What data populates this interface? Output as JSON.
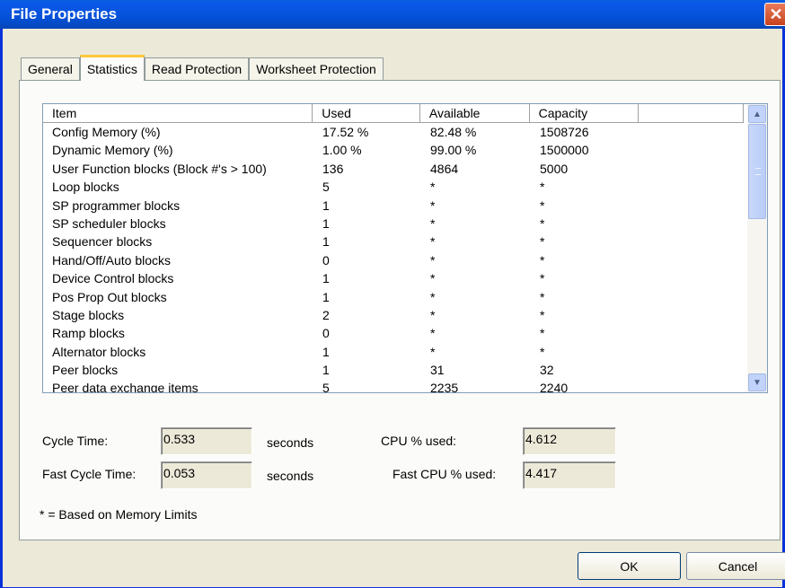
{
  "window": {
    "title": "File Properties",
    "close_glyph": "✕"
  },
  "tabs": [
    {
      "label": "General"
    },
    {
      "label": "Statistics"
    },
    {
      "label": "Read Protection"
    },
    {
      "label": "Worksheet Protection"
    }
  ],
  "table": {
    "columns": [
      "Item",
      "Used",
      "Available",
      "Capacity"
    ],
    "rows": [
      [
        "Config Memory (%)",
        "17.52 %",
        "82.48 %",
        "1508726"
      ],
      [
        "Dynamic Memory (%)",
        "1.00 %",
        "99.00 %",
        "1500000"
      ],
      [
        "User Function blocks (Block #'s > 100)",
        "136",
        "4864",
        "5000"
      ],
      [
        "Loop blocks",
        "5",
        "*",
        "*"
      ],
      [
        "SP programmer blocks",
        "1",
        "*",
        "*"
      ],
      [
        "SP scheduler blocks",
        "1",
        "*",
        "*"
      ],
      [
        "Sequencer blocks",
        "1",
        "*",
        "*"
      ],
      [
        "Hand/Off/Auto blocks",
        "0",
        "*",
        "*"
      ],
      [
        "Device Control blocks",
        "1",
        "*",
        "*"
      ],
      [
        "Pos Prop Out blocks",
        "1",
        "*",
        "*"
      ],
      [
        "Stage blocks",
        "2",
        "*",
        "*"
      ],
      [
        "Ramp blocks",
        "0",
        "*",
        "*"
      ],
      [
        "Alternator blocks",
        "1",
        "*",
        "*"
      ],
      [
        "Peer blocks",
        "1",
        "31",
        "32"
      ],
      [
        "Peer data exchange items",
        "5",
        "2235",
        "2240"
      ]
    ]
  },
  "stats": {
    "cycle_time_label": "Cycle Time:",
    "cycle_time_value": "0.533",
    "cycle_time_unit": "seconds",
    "fast_cycle_time_label": "Fast Cycle Time:",
    "fast_cycle_time_value": "0.053",
    "fast_cycle_time_unit": "seconds",
    "cpu_used_label": "CPU % used:",
    "cpu_used_value": "4.612",
    "fast_cpu_used_label": "Fast CPU % used:",
    "fast_cpu_used_value": "4.417",
    "footnote": "* = Based on Memory Limits"
  },
  "buttons": {
    "ok": "OK",
    "cancel": "Cancel"
  },
  "colors": {
    "titlebar": "#0451d8",
    "tab_highlight": "#ffc83c",
    "close": "#c8411c"
  }
}
